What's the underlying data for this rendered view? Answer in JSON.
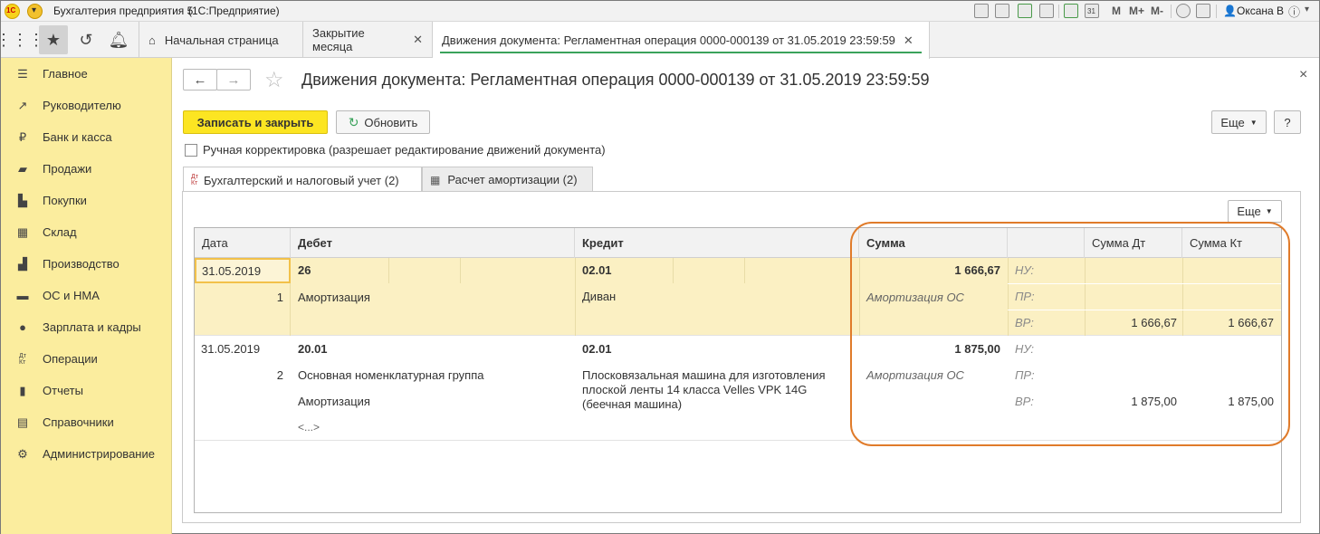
{
  "app": {
    "title": "Бухгалтерия предприятия 5",
    "platform": "(1С:Предприятие)",
    "user": "Оксана В",
    "toolbar_m": [
      "M",
      "M+",
      "M-"
    ]
  },
  "window_tabs": [
    {
      "label": "Начальная страница"
    },
    {
      "label": "Закрытие месяца"
    },
    {
      "label": "Движения документа: Регламентная операция 0000-000139 от 31.05.2019 23:59:59"
    }
  ],
  "sidebar": {
    "items": [
      {
        "label": "Главное",
        "icon": "menu-icon"
      },
      {
        "label": "Руководителю",
        "icon": "trend-icon"
      },
      {
        "label": "Банк и касса",
        "icon": "ruble-icon"
      },
      {
        "label": "Продажи",
        "icon": "bag-icon"
      },
      {
        "label": "Покупки",
        "icon": "cart-icon"
      },
      {
        "label": "Склад",
        "icon": "warehouse-icon"
      },
      {
        "label": "Производство",
        "icon": "factory-icon"
      },
      {
        "label": "ОС и НМА",
        "icon": "truck-icon"
      },
      {
        "label": "Зарплата и кадры",
        "icon": "person-icon"
      },
      {
        "label": "Операции",
        "icon": "dt-kt-icon"
      },
      {
        "label": "Отчеты",
        "icon": "bar-chart-icon"
      },
      {
        "label": "Справочники",
        "icon": "books-icon"
      },
      {
        "label": "Администрирование",
        "icon": "gear-icon"
      }
    ]
  },
  "form": {
    "title": "Движения документа: Регламентная операция 0000-000139 от 31.05.2019 23:59:59",
    "close": "×",
    "save_close": "Записать и закрыть",
    "refresh": "Обновить",
    "more": "Еще",
    "help": "?",
    "manual_edit_label": "Ручная корректировка (разрешает редактирование движений документа)",
    "manual_edit_checked": false,
    "tabs": [
      {
        "label": "Бухгалтерский и налоговый учет (2)",
        "active": true
      },
      {
        "label": "Расчет амортизации (2)",
        "active": false
      }
    ],
    "grid_more": "Еще",
    "dtkt": [
      "Дт",
      "Кт"
    ]
  },
  "grid": {
    "columns": [
      "Дата",
      "Дебет",
      "Кредит",
      "Сумма",
      "",
      "Сумма Дт",
      "Сумма Кт"
    ],
    "rows": [
      {
        "date": "31.05.2019",
        "num": "1",
        "debit_account": "26",
        "debit_sub": [
          "Амортизация"
        ],
        "credit_account": "02.01",
        "credit_sub": [
          "Диван"
        ],
        "amount": "1 666,67",
        "content": "Амортизация ОС",
        "types": [
          "НУ:",
          "ПР:",
          "ВР:"
        ],
        "sum_dt": "1 666,67",
        "sum_kt": "1 666,67"
      },
      {
        "date": "31.05.2019",
        "num": "2",
        "debit_account": "20.01",
        "debit_sub": [
          "Основная номенклатурная группа",
          "Амортизация",
          "<...>"
        ],
        "credit_account": "02.01",
        "credit_sub": [
          "Плосковязальная машина для изготовления",
          "плоской ленты 14 класса Velles VPK 14G",
          "(беечная машина)"
        ],
        "amount": "1 875,00",
        "content": "Амортизация ОС",
        "types": [
          "НУ:",
          "ПР:",
          "ВР:"
        ],
        "sum_dt": "1 875,00",
        "sum_kt": "1 875,00"
      }
    ]
  },
  "colors": {
    "sidebar": "#fbed9e",
    "selected_row": "#fbf0c3",
    "primary_button": "#fce522",
    "highlight_ellipse": "#e07b2a",
    "active_tab_underline": "#3aa25b"
  }
}
